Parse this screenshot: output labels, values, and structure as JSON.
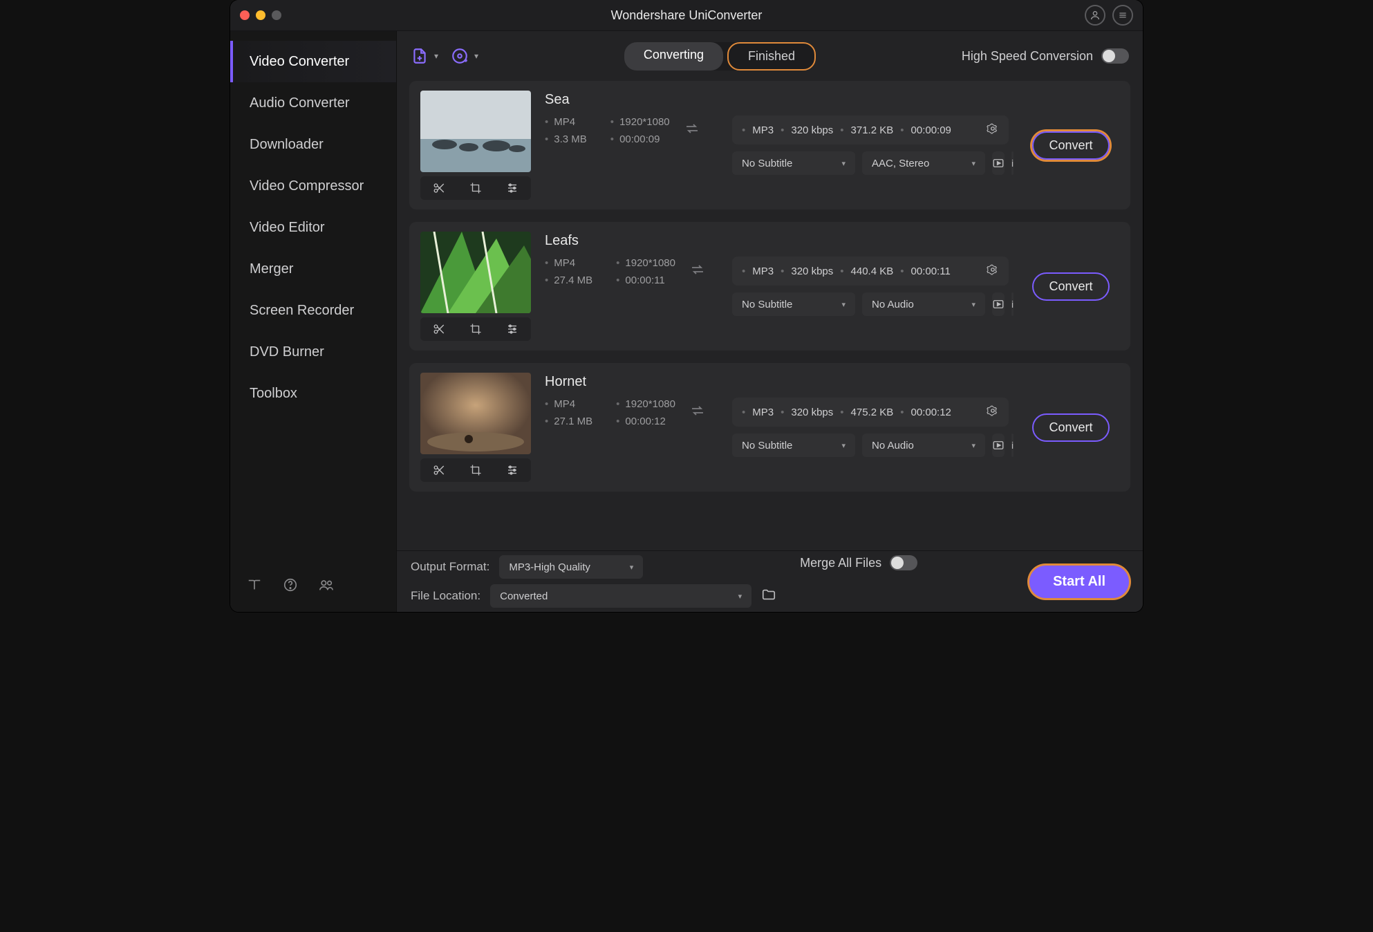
{
  "app": {
    "title": "Wondershare UniConverter"
  },
  "sidebar": {
    "items": [
      {
        "label": "Video Converter",
        "active": true
      },
      {
        "label": "Audio Converter"
      },
      {
        "label": "Downloader"
      },
      {
        "label": "Video Compressor"
      },
      {
        "label": "Video Editor"
      },
      {
        "label": "Merger"
      },
      {
        "label": "Screen Recorder"
      },
      {
        "label": "DVD Burner"
      },
      {
        "label": "Toolbox"
      }
    ]
  },
  "toolbar": {
    "tabs": {
      "converting": "Converting",
      "finished": "Finished"
    },
    "high_speed_label": "High Speed Conversion"
  },
  "items": [
    {
      "name": "Sea",
      "src": {
        "format": "MP4",
        "resolution": "1920*1080",
        "size": "3.3 MB",
        "duration": "00:00:09"
      },
      "dst": {
        "format": "MP3",
        "bitrate": "320 kbps",
        "size": "371.2 KB",
        "duration": "00:00:09",
        "subtitle": "No Subtitle",
        "audio": "AAC, Stereo"
      },
      "convert_label": "Convert",
      "highlight": true
    },
    {
      "name": "Leafs",
      "src": {
        "format": "MP4",
        "resolution": "1920*1080",
        "size": "27.4 MB",
        "duration": "00:00:11"
      },
      "dst": {
        "format": "MP3",
        "bitrate": "320 kbps",
        "size": "440.4 KB",
        "duration": "00:00:11",
        "subtitle": "No Subtitle",
        "audio": "No Audio"
      },
      "convert_label": "Convert",
      "highlight": false
    },
    {
      "name": "Hornet",
      "src": {
        "format": "MP4",
        "resolution": "1920*1080",
        "size": "27.1 MB",
        "duration": "00:00:12"
      },
      "dst": {
        "format": "MP3",
        "bitrate": "320 kbps",
        "size": "475.2 KB",
        "duration": "00:00:12",
        "subtitle": "No Subtitle",
        "audio": "No Audio"
      },
      "convert_label": "Convert",
      "highlight": false
    }
  ],
  "footer": {
    "output_label": "Output Format:",
    "output_value": "MP3-High Quality",
    "location_label": "File Location:",
    "location_value": "Converted",
    "merge_label": "Merge All Files",
    "start_all": "Start All"
  }
}
